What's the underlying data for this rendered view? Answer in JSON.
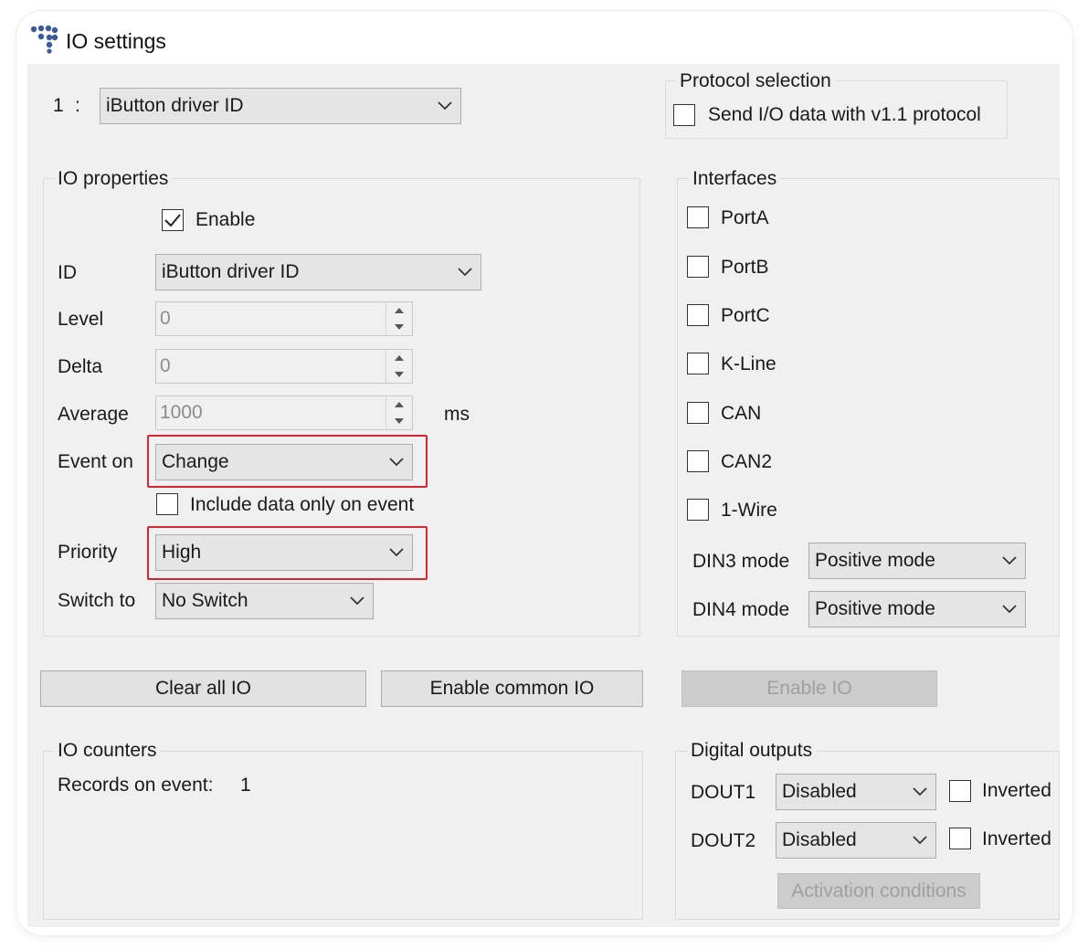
{
  "window": {
    "title": "IO settings"
  },
  "io_index": "1",
  "io_separator": ":",
  "io_selector": {
    "value": "iButton driver ID"
  },
  "protocol": {
    "group_label": "Protocol selection",
    "send_v11_label": "Send I/O data with v1.1 protocol",
    "send_v11_checked": false
  },
  "io_properties": {
    "group_label": "IO properties",
    "enable_label": "Enable",
    "enable_checked": true,
    "id_label": "ID",
    "id_value": "iButton driver ID",
    "level_label": "Level",
    "level_value": "0",
    "delta_label": "Delta",
    "delta_value": "0",
    "average_label": "Average",
    "average_value": "1000",
    "average_unit": "ms",
    "event_on_label": "Event on",
    "event_on_value": "Change",
    "include_data_label": "Include data only on event",
    "include_data_checked": false,
    "priority_label": "Priority",
    "priority_value": "High",
    "switch_to_label": "Switch to",
    "switch_to_value": "No Switch"
  },
  "interfaces": {
    "group_label": "Interfaces",
    "items": [
      {
        "label": "PortA",
        "checked": false
      },
      {
        "label": "PortB",
        "checked": false
      },
      {
        "label": "PortC",
        "checked": false
      },
      {
        "label": "K-Line",
        "checked": false
      },
      {
        "label": "CAN",
        "checked": false
      },
      {
        "label": "CAN2",
        "checked": false
      },
      {
        "label": "1-Wire",
        "checked": false
      }
    ],
    "din3_label": "DIN3 mode",
    "din3_value": "Positive mode",
    "din4_label": "DIN4 mode",
    "din4_value": "Positive mode"
  },
  "buttons": {
    "clear_all": "Clear all IO",
    "enable_common": "Enable common IO",
    "enable_io": "Enable IO"
  },
  "io_counters": {
    "group_label": "IO counters",
    "records_label": "Records on event:",
    "records_value": "1"
  },
  "digital_outputs": {
    "group_label": "Digital outputs",
    "dout1_label": "DOUT1",
    "dout1_value": "Disabled",
    "dout1_inverted_label": "Inverted",
    "dout2_label": "DOUT2",
    "dout2_value": "Disabled",
    "dout2_inverted_label": "Inverted",
    "activation_label": "Activation conditions"
  },
  "colors": {
    "highlight": "#d9272f",
    "client_bg": "#f0f0f0",
    "logo_blue": "#3d5a9a"
  }
}
